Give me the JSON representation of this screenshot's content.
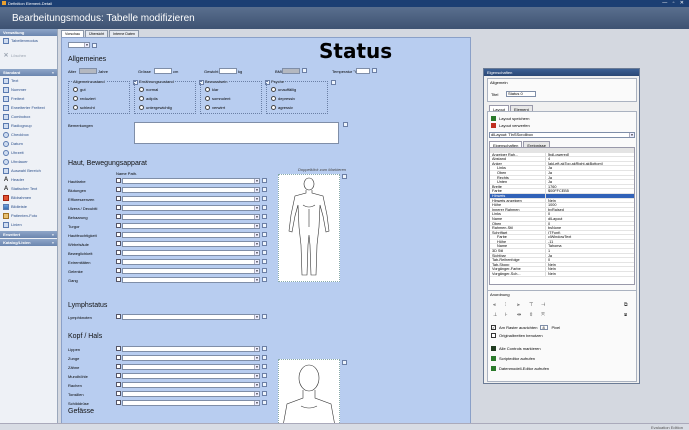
{
  "window": {
    "title": "Definition Element-Detail",
    "min": "—",
    "max": "▫",
    "close": "✕"
  },
  "header": {
    "mode": "Bearbeitungsmodus: Tabelle modifizieren"
  },
  "left_panel": {
    "sec_verwaltung": "Verwaltung",
    "verwaltung_items": [
      {
        "icon": "tab-icon",
        "label": "Tabellenmodus"
      },
      {
        "icon": "delete-icon",
        "label": "Löschen"
      }
    ],
    "sec_standard": "Standard",
    "standard_items": [
      {
        "icon": "text-icon",
        "label": "Text"
      },
      {
        "icon": "number-icon",
        "label": "Nummer"
      },
      {
        "icon": "textfield-icon",
        "label": "Freitext"
      },
      {
        "icon": "extended-text-icon",
        "label": "Erweiterter Freitext"
      },
      {
        "icon": "combobox-icon",
        "label": "Combobox"
      },
      {
        "icon": "radiogroup-icon",
        "label": "Radiogroup"
      },
      {
        "icon": "checkbox-icon",
        "label": "Checkbox"
      },
      {
        "icon": "date-icon",
        "label": "Datum"
      },
      {
        "icon": "time-icon",
        "label": "Uhrzeit"
      },
      {
        "icon": "duration-icon",
        "label": "Uhrdauer"
      },
      {
        "icon": "group-icon",
        "label": "Auswahl Bereich"
      },
      {
        "icon": "label-icon",
        "label": "Header"
      },
      {
        "icon": "static-text-icon",
        "label": "Statischer Text"
      },
      {
        "icon": "frame-icon",
        "label": "Bildrahmen"
      },
      {
        "icon": "image-icon",
        "label": "Bildleiste"
      },
      {
        "icon": "patient-photo-icon",
        "label": "Patienten-Foto"
      },
      {
        "icon": "line-icon",
        "label": "Linien"
      }
    ],
    "sec_erweitert": "Erweitert",
    "sec_katalog": "Katalog/Listen"
  },
  "tabs": [
    "Vorschau",
    "Übersicht",
    "Interne Daten"
  ],
  "form": {
    "title": "Status",
    "allgemeines": "Allgemeines",
    "alter_label": "Alter",
    "jahre": "Jahre",
    "groesse_label": "Grösse",
    "cm": "cm",
    "gewicht_label": "Gewicht",
    "kg": "kg",
    "bmi_label": "BMI",
    "temperatur_label": "Temperatur °C",
    "groups": [
      {
        "title": "Allgemeinzustand",
        "options": [
          "gut",
          "reduziert",
          "schlecht"
        ]
      },
      {
        "title": "Ernährungszustand",
        "options": [
          "normal",
          "adipös",
          "untergewichtig"
        ]
      },
      {
        "title": "Bewusstsein",
        "options": [
          "klar",
          "somnolent",
          "verwirrt"
        ]
      },
      {
        "title": "Psyche",
        "options": [
          "unauffällig",
          "depressiv",
          "agressiv"
        ]
      }
    ],
    "bemerkungen": "Bemerkungen",
    "haut_title": "Haut, Bewegungsapparat",
    "name_path": "Name Path.",
    "haut_rows": [
      "Hautfarbe",
      "Blutungen",
      "Effloreszenzen",
      "Ulzera / Decubiti",
      "Behaarung",
      "Turgor",
      "Hautfeuchtigkeit",
      "Wirbelsäule",
      "Beweglichkeit",
      "Extremitäten",
      "Gelenke",
      "Gang"
    ],
    "image_caption": "Doppelklick zum Markieren",
    "lymph_title": "Lymphstatus",
    "lymph_rows": [
      "Lymphknoten"
    ],
    "kopf_title": "Kopf / Hals",
    "kopf_rows": [
      "Lippen",
      "Zunge",
      "Zähne",
      "Mundhöhle",
      "Rachen",
      "Tonsillen",
      "Schilddrüse"
    ],
    "gefaesse_title": "Gefässe"
  },
  "props": {
    "title": "Eigenschaften",
    "allgemein": "Allgemein",
    "titel_label": "Titel",
    "titel_value": "Status 0",
    "tab_layout": "Layout",
    "tab_element": "Element",
    "layout_speichern": "Layout speichern",
    "layout_verwerfen": "Layout verwerfen",
    "layout_combo": "dlLayout: TlnSScrollbox",
    "tab_eigenschaften": "Eigenschaften",
    "tab_ereignisse": "Ereignisse",
    "rows": [
      [
        "Anzeiger Rah...",
        "[bdLowered]"
      ],
      [
        "Abstand",
        "4"
      ],
      [
        "Anker",
        "[akLeft,akTop,akRight,akBottom]"
      ],
      [
        "Links",
        "Ja"
      ],
      [
        "Oben",
        "Ja"
      ],
      [
        "Rechts",
        "Ja"
      ],
      [
        "Unten",
        "Ja"
      ],
      [
        "Breite",
        "1760"
      ],
      [
        "Farbe",
        "$00FFCEB5"
      ],
      [
        "Hinweis",
        ""
      ],
      [
        "Hinweis anzeigen",
        "Nein"
      ],
      [
        "Höhe",
        "1000"
      ],
      [
        "Innerer Rahmen",
        "bvRaised"
      ],
      [
        "Links",
        "0"
      ],
      [
        "Name",
        "dlLayout"
      ],
      [
        "Oben",
        "0"
      ],
      [
        "Rahmen-Stil",
        "bsNone"
      ],
      [
        "Schriftart",
        "(TFont)"
      ],
      [
        "Farbe",
        "clWindowText"
      ],
      [
        "Höhe",
        "-11"
      ],
      [
        "Name",
        "Tahoma"
      ],
      [
        "3D Stil",
        "1"
      ],
      [
        "Sichtbar",
        "Ja"
      ],
      [
        "Tab-Reihenfolge",
        "0"
      ],
      [
        "Tab-Stopp",
        "Nein"
      ],
      [
        "Vorgänger-Farbe",
        "Nein"
      ],
      [
        "Vorgänger-Sch...",
        "Nein"
      ]
    ],
    "anordnung": "Anordnung",
    "am_raster": "Am Raster ausrichten",
    "raster_value": "8",
    "pixel": "Pixel",
    "originalbreiten": "Originalbreiten benutzen",
    "btn_alle": "Alle Controls markieren",
    "btn_scripteditor": "Scripteditor aufrufen",
    "btn_datenmodell": "Datenmodell-Editor aufrufen"
  },
  "footer": {
    "brand": "Evaluation Edition"
  },
  "colors": {
    "accent": "#1c3f73",
    "form_bg": "#b8cdf0",
    "selected": "#3162b8"
  }
}
